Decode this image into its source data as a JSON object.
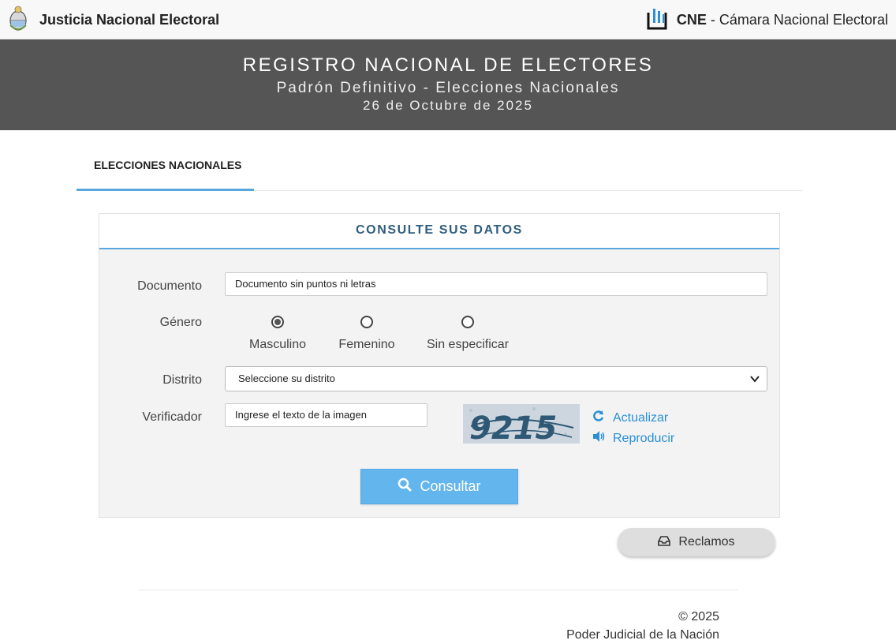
{
  "topbar": {
    "brand": "Justicia Nacional Electoral",
    "cne_abbr": "CNE",
    "cne_name": " - Cámara Nacional Electoral"
  },
  "banner": {
    "title": "REGISTRO NACIONAL DE ELECTORES",
    "subtitle": "Padrón Definitivo - Elecciones Nacionales",
    "date": "26 de Octubre de 2025"
  },
  "tabs": [
    {
      "label": "ELECCIONES NACIONALES",
      "active": true
    }
  ],
  "form": {
    "heading": "CONSULTE SUS DATOS",
    "documento_label": "Documento",
    "documento_placeholder": "Documento sin puntos ni letras",
    "genero_label": "Género",
    "genero_options": [
      "Masculino",
      "Femenino",
      "Sin especificar"
    ],
    "genero_selected": "Masculino",
    "distrito_label": "Distrito",
    "distrito_selected": "Seleccione su distrito",
    "verificador_label": "Verificador",
    "verificador_placeholder": "Ingrese el texto de la imagen",
    "captcha_text": "9215",
    "actualizar": "Actualizar",
    "reproducir": "Reproducir",
    "submit": "Consultar"
  },
  "reclamos": "Reclamos",
  "footer": {
    "copyright": "© 2025",
    "org": "Poder Judicial de la Nación"
  },
  "colors": {
    "accent": "#5aa7e0",
    "banner": "#555555",
    "heading": "#2e5d7e",
    "link": "#2a8fd8"
  },
  "icons": [
    "coat-of-arms-icon",
    "cne-logo-icon",
    "refresh-icon",
    "speaker-icon",
    "search-icon",
    "inbox-icon",
    "chevron-down-icon"
  ]
}
